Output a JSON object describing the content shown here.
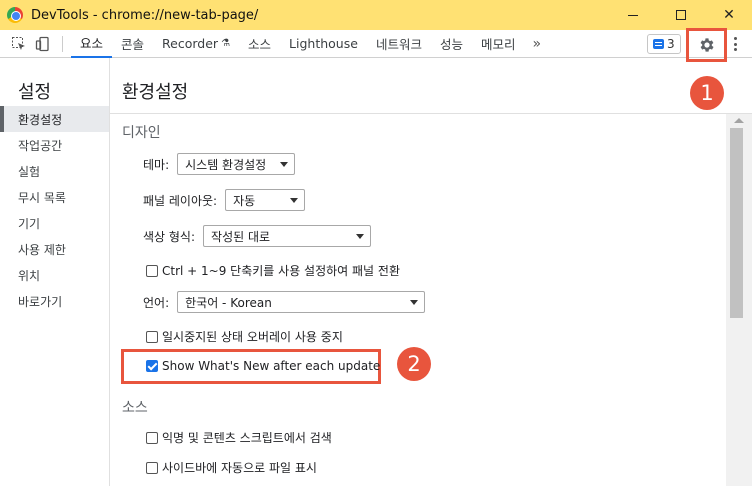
{
  "window": {
    "title": "DevTools - chrome://new-tab-page/",
    "minimize": "—",
    "maximize": "☐",
    "close": "✕"
  },
  "tabs": [
    {
      "label": "요소"
    },
    {
      "label": "콘솔"
    },
    {
      "label": "Recorder",
      "suffix": "⚗"
    },
    {
      "label": "소스"
    },
    {
      "label": "Lighthouse"
    },
    {
      "label": "네트워크"
    },
    {
      "label": "성능"
    },
    {
      "label": "메모리"
    }
  ],
  "more_tabs": "»",
  "issues": {
    "count": "3"
  },
  "sidebar": {
    "title": "설정",
    "items": [
      {
        "label": "환경설정"
      },
      {
        "label": "작업공간"
      },
      {
        "label": "실험"
      },
      {
        "label": "무시 목록"
      },
      {
        "label": "기기"
      },
      {
        "label": "사용 제한"
      },
      {
        "label": "위치"
      },
      {
        "label": "바로가기"
      }
    ]
  },
  "main": {
    "title": "환경설정",
    "design": {
      "title": "디자인",
      "theme": {
        "label": "테마:",
        "value": "시스템 환경설정"
      },
      "panel_layout": {
        "label": "패널 레이아웃:",
        "value": "자동"
      },
      "color_format": {
        "label": "색상 형식:",
        "value": "작성된 대로"
      },
      "ctrl_shortcut": {
        "label": "Ctrl + 1~9 단축키를 사용 설정하여 패널 전환",
        "checked": false
      },
      "language": {
        "label": "언어:",
        "value": "한국어 - Korean"
      },
      "disable_overlay": {
        "label": "일시중지된 상태 오버레이 사용 중지",
        "checked": false
      },
      "show_whats_new": {
        "label": "Show What's New after each update",
        "checked": true
      }
    },
    "sources": {
      "title": "소스",
      "search_anonymous": {
        "label": "익명 및 콘텐츠 스크립트에서 검색",
        "checked": false
      },
      "reveal_in_sidebar": {
        "label": "사이드바에 자동으로 파일 표시",
        "checked": false
      }
    }
  },
  "annotations": {
    "step1": "1",
    "step2": "2"
  }
}
